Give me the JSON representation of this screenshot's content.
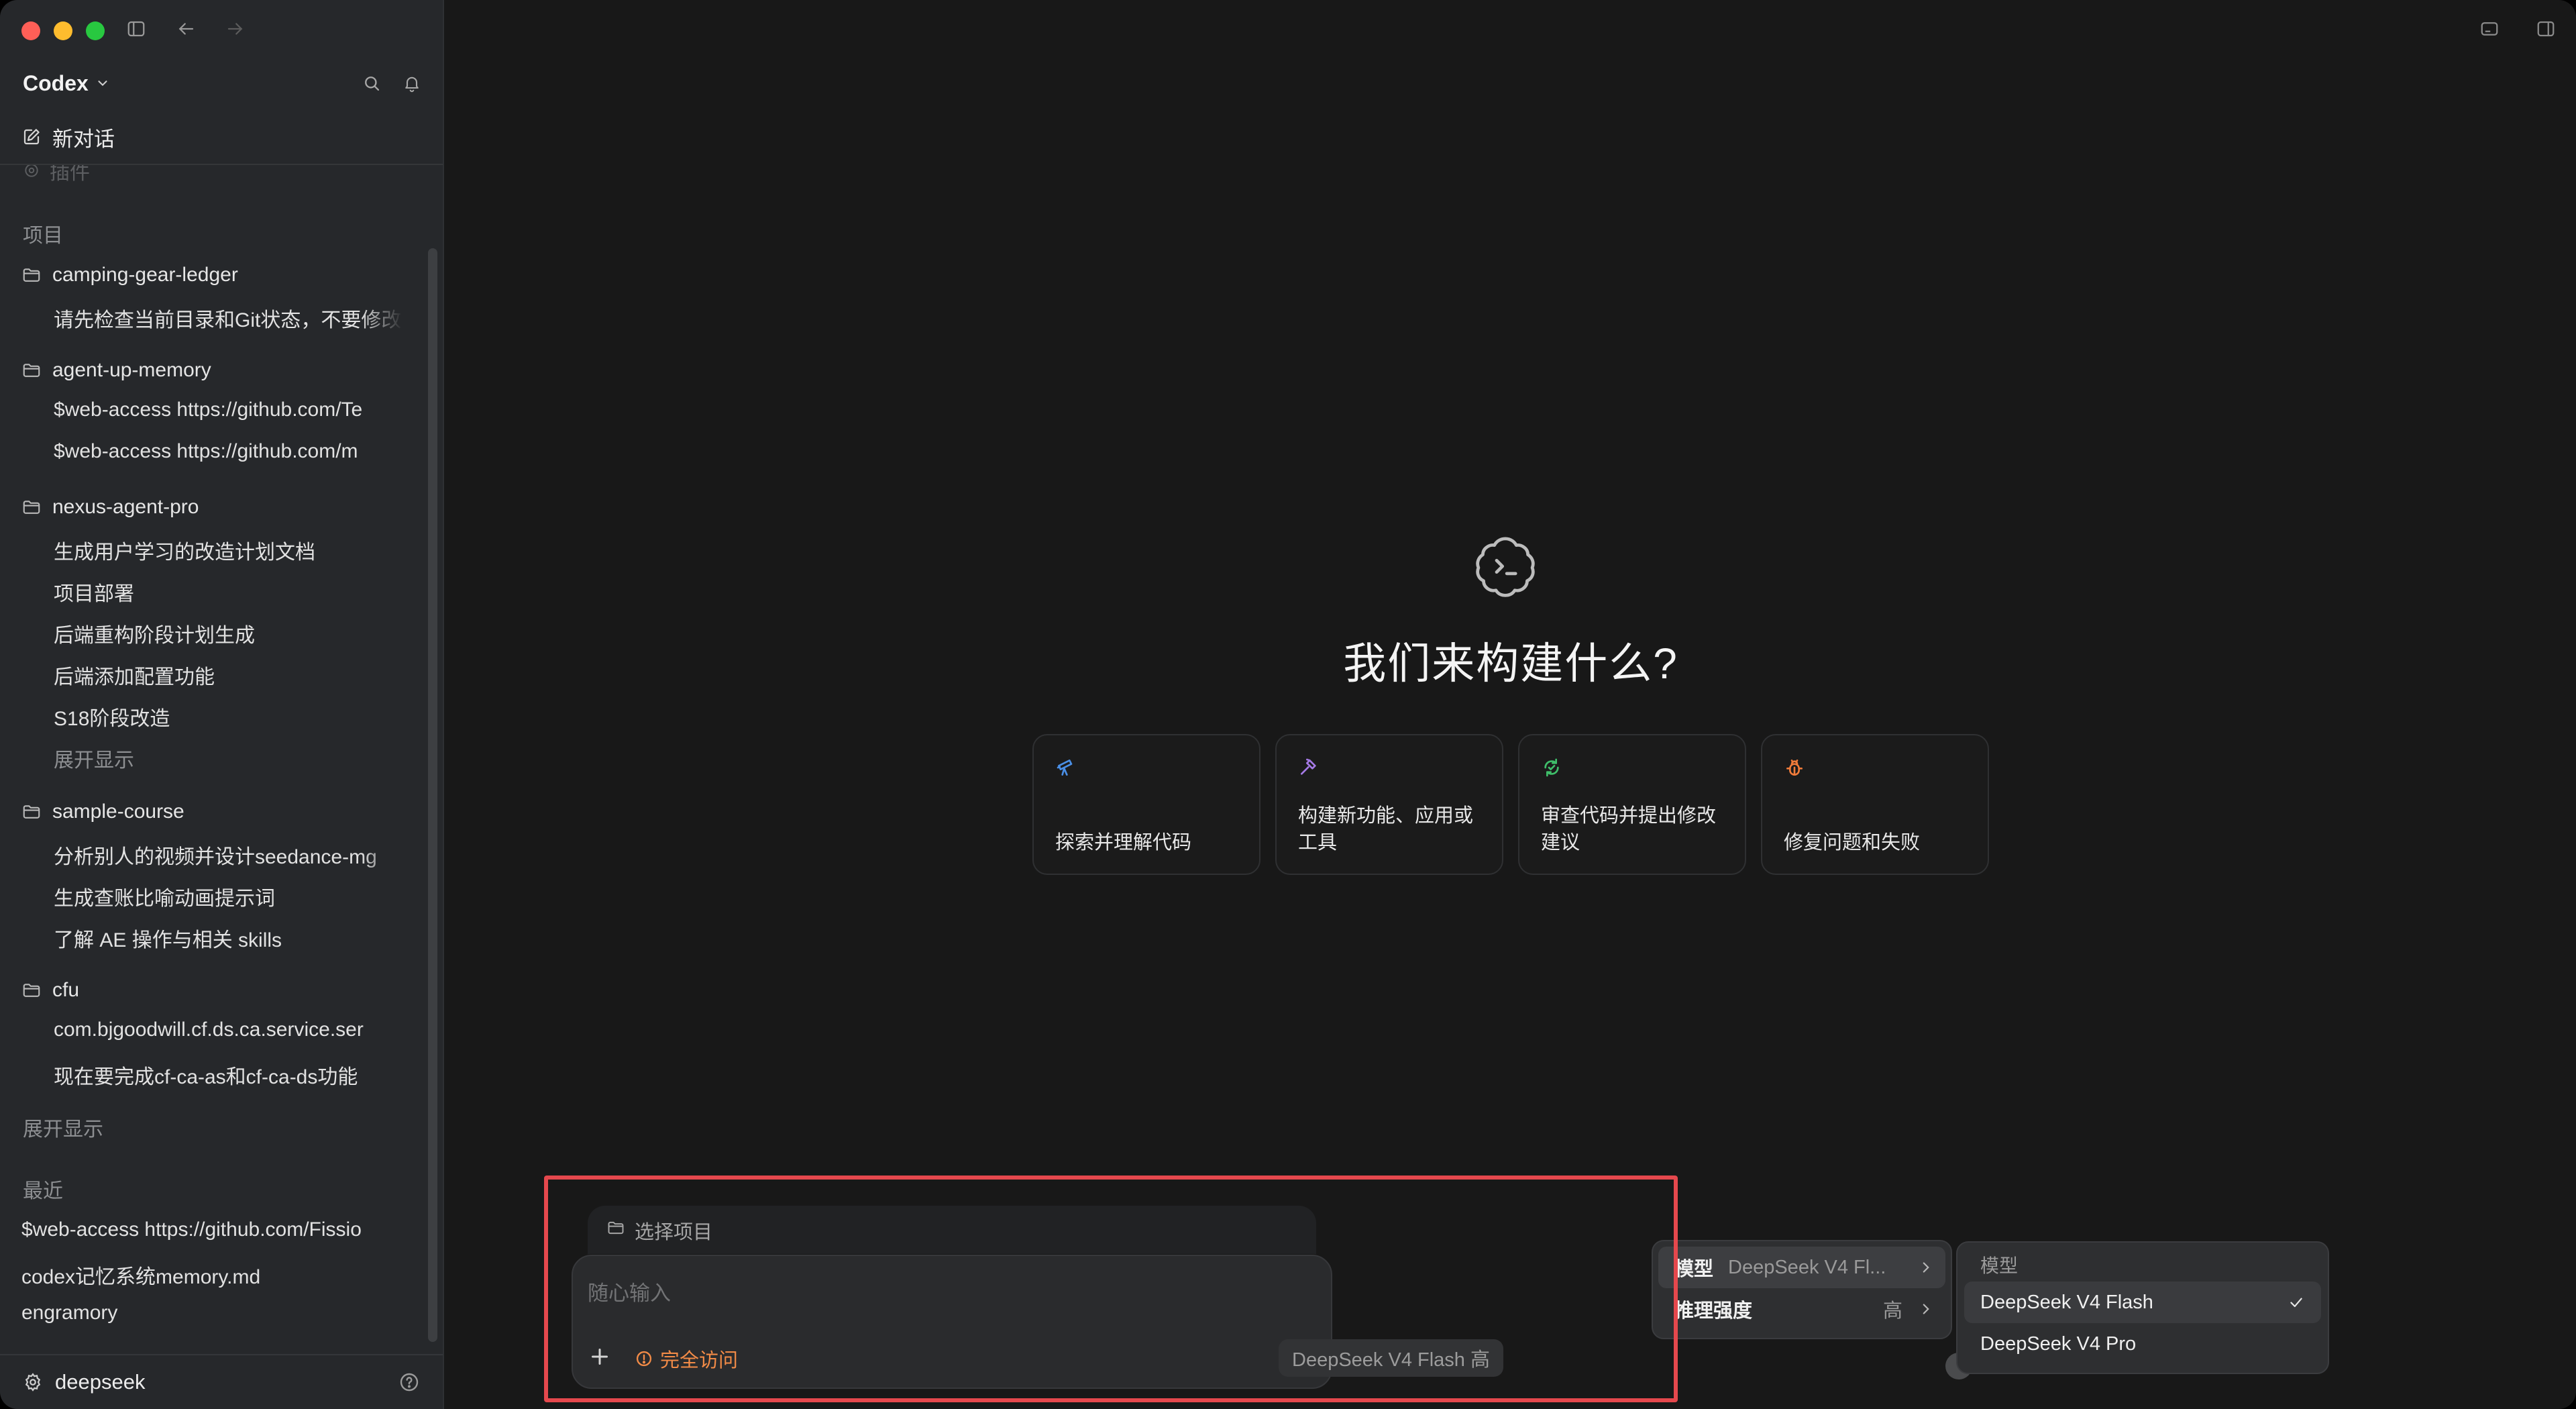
{
  "app": {
    "name": "Codex"
  },
  "sidebar": {
    "new_chat": "新对话",
    "plugins": "插件",
    "projects_title": "项目",
    "projects": [
      {
        "name": "camping-gear-ledger",
        "threads": [
          "请先检查当前目录和Git状态，不要修改"
        ]
      },
      {
        "name": "agent-up-memory",
        "threads": [
          "$web-access https://github.com/Te",
          "$web-access https://github.com/m"
        ]
      },
      {
        "name": "nexus-agent-pro",
        "threads": [
          "生成用户学习的改造计划文档",
          "项目部署",
          "后端重构阶段计划生成",
          "后端添加配置功能",
          "S18阶段改造"
        ],
        "more": "展开显示"
      },
      {
        "name": "sample-course",
        "threads": [
          "分析别人的视频并设计seedance-mg",
          "生成查账比喻动画提示词",
          "了解 AE 操作与相关 skills"
        ]
      },
      {
        "name": "cfu",
        "threads": [
          "com.bjgoodwill.cf.ds.ca.service.ser",
          "现在要完成cf-ca-as和cf-ca-ds功能"
        ]
      }
    ],
    "projects_more": "展开显示",
    "recent_title": "最近",
    "recent": [
      "$web-access https://github.com/Fissio",
      "codex记忆系统memory.md",
      "engramory"
    ],
    "user": "deepseek"
  },
  "main": {
    "title": "我们来构建什么?",
    "cards": [
      {
        "icon": "telescope-icon",
        "label": "探索并理解代码",
        "color": "#4a8fe6"
      },
      {
        "icon": "hammer-icon",
        "label": "构建新功能、应用或工具",
        "color": "#a57ae6"
      },
      {
        "icon": "review-icon",
        "label": "审查代码并提出修改建议",
        "color": "#3fbf6a"
      },
      {
        "icon": "bug-icon",
        "label": "修复问题和失败",
        "color": "#f07b3a"
      }
    ],
    "project_select": "选择项目",
    "composer_placeholder": "随心输入",
    "access_label": "完全访问",
    "model_chip": "DeepSeek V4 Flash 高"
  },
  "menu": {
    "model_label": "模型",
    "model_value": "DeepSeek V4 Fl...",
    "effort_label": "推理强度",
    "effort_value": "高"
  },
  "submenu": {
    "title": "模型",
    "options": [
      "DeepSeek V4 Flash",
      "DeepSeek V4 Pro"
    ],
    "selected": "DeepSeek V4 Flash"
  },
  "colors": {
    "accent_access": "#f28b47",
    "highlight_box": "#e5484d"
  }
}
